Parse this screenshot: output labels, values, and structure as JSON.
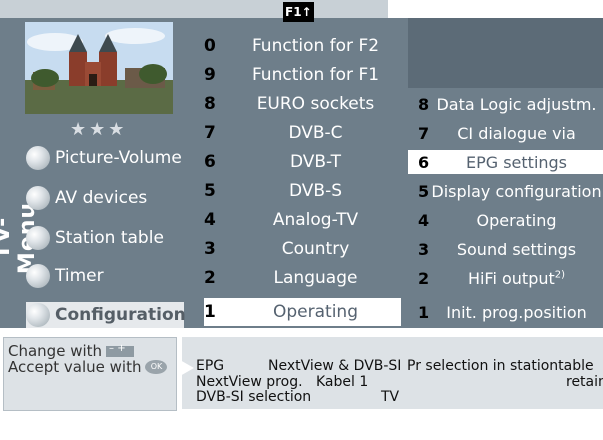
{
  "top": {
    "badge": "F1↑"
  },
  "left": {
    "stars": "★★★",
    "menu_title": "TV-Menu",
    "items": [
      {
        "label": "Picture-Volume"
      },
      {
        "label": "AV devices"
      },
      {
        "label": "Station table"
      },
      {
        "label": "Timer"
      },
      {
        "label": "Configuration"
      }
    ],
    "selected_index": 4
  },
  "middle": {
    "items": [
      {
        "num": "0",
        "label": "Function for F2"
      },
      {
        "num": "9",
        "label": "Function for F1"
      },
      {
        "num": "8",
        "label": "EURO sockets"
      },
      {
        "num": "7",
        "label": "DVB-C"
      },
      {
        "num": "6",
        "label": "DVB-T"
      },
      {
        "num": "5",
        "label": "DVB-S"
      },
      {
        "num": "4",
        "label": "Analog-TV"
      },
      {
        "num": "3",
        "label": "Country"
      },
      {
        "num": "2",
        "label": "Language"
      },
      {
        "num": "1",
        "label": "Operating"
      }
    ],
    "selected_index": 9
  },
  "right": {
    "items": [
      {
        "num": "8",
        "label": "Data Logic adjustm."
      },
      {
        "num": "7",
        "label": "CI dialogue via"
      },
      {
        "num": "6",
        "label": "EPG settings"
      },
      {
        "num": "5",
        "label": "Display configuration"
      },
      {
        "num": "4",
        "label": "Operating"
      },
      {
        "num": "3",
        "label": "Sound settings"
      },
      {
        "num": "2",
        "label": "HiFi output",
        "sup": "2)"
      },
      {
        "num": "1",
        "label": "Init. prog.position"
      }
    ],
    "selected_index": 2
  },
  "help": {
    "change_with": "Change with",
    "accept_with": "Accept value with",
    "ok_label": "OK"
  },
  "info": {
    "line1_a": "EPG",
    "line1_b": "NextView & DVB-SI",
    "line1_c": "Pr selection in stationtable",
    "line2_a": "NextView prog.",
    "line2_b": "Kabel 1",
    "line2_c": "retain",
    "line3_a": "DVB-SI selection",
    "line3_b": "TV"
  }
}
